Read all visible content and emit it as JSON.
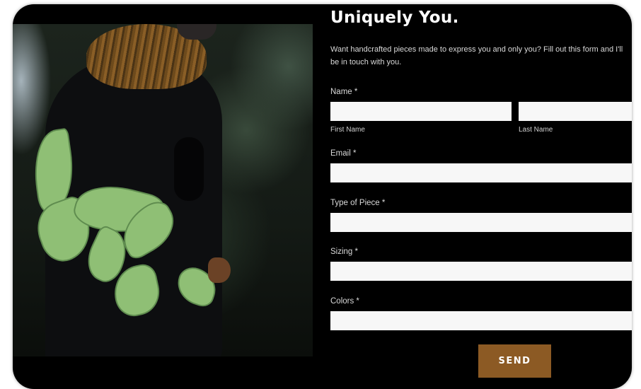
{
  "form": {
    "heading": "Uniquely You.",
    "intro": "Want handcrafted pieces made to express you and only you? Fill out this form and I'll be in touch with you.",
    "name_label": "Name *",
    "first_name": {
      "value": "",
      "sublabel": "First Name"
    },
    "last_name": {
      "value": "",
      "sublabel": "Last Name"
    },
    "email": {
      "label": "Email *",
      "value": ""
    },
    "type_of_piece": {
      "label": "Type of Piece *",
      "value": ""
    },
    "sizing": {
      "label": "Sizing *",
      "value": ""
    },
    "colors": {
      "label": "Colors *",
      "value": ""
    },
    "send_label": "SEND"
  },
  "theme": {
    "background": "#000000",
    "field_background": "#f7f7f7",
    "button_color": "#8c5a24",
    "text_color": "#ffffff"
  }
}
